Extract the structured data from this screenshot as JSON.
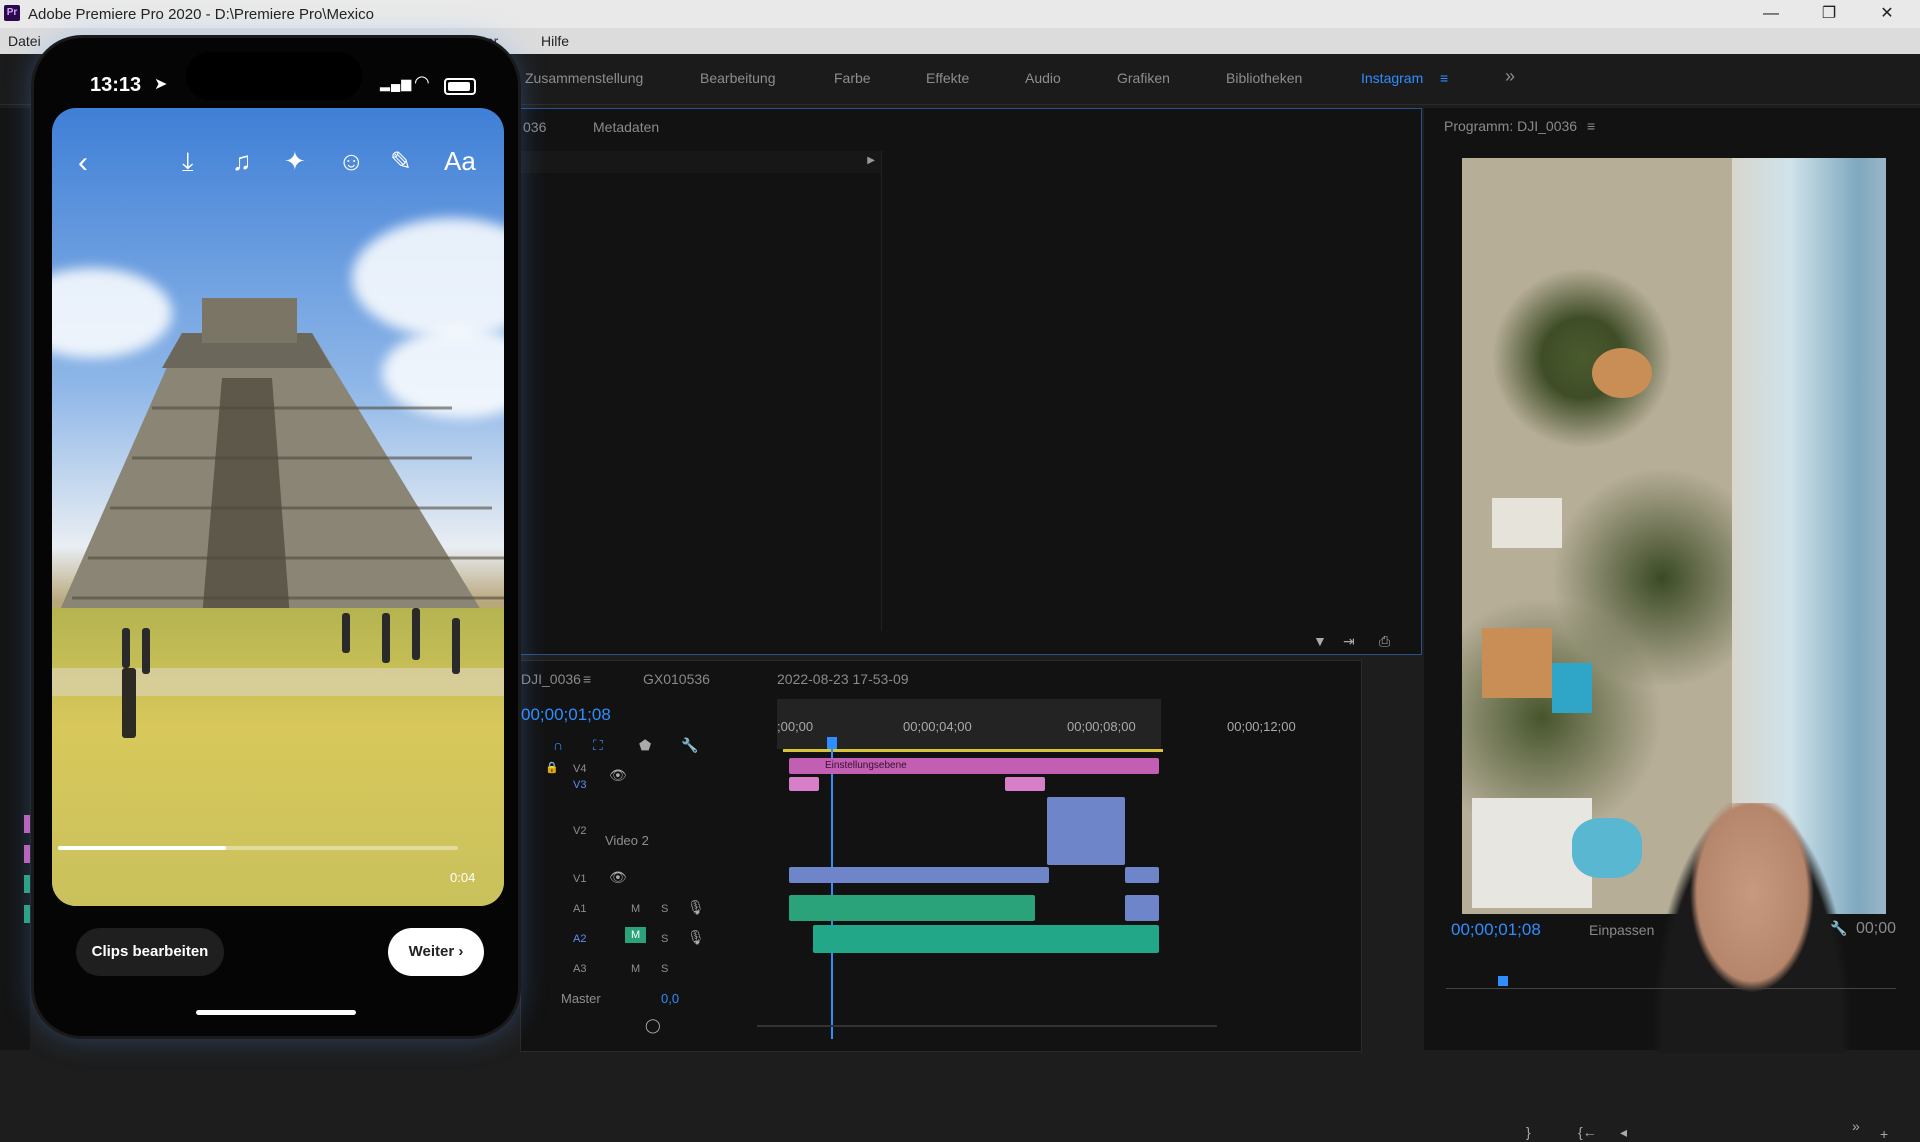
{
  "window": {
    "title": "Adobe Premiere Pro 2020 - D:\\Premiere Pro\\Mexico",
    "minimize": "—",
    "restore": "❐",
    "close": "✕"
  },
  "menu": {
    "file": "Datei",
    "help": "Hilfe",
    "window_partial": "ster"
  },
  "workspaces": {
    "tabs": [
      "Zusammenstellung",
      "Bearbeitung",
      "Farbe",
      "Effekte",
      "Audio",
      "Grafiken",
      "Bibliotheken",
      "Instagram"
    ],
    "active": "Instagram",
    "overflow": "»"
  },
  "source": {
    "tab_partial": "036",
    "metadata": "Metadaten"
  },
  "program": {
    "title": "Programm: DJI_0036",
    "timecode": "00;00;01;08",
    "fit": "Einpassen",
    "end_timecode": "00;00"
  },
  "timeline": {
    "tabs": [
      "DJI_0036",
      "GX010536",
      "2022-08-23 17-53-09"
    ],
    "timecode": "00;00;01;08",
    "ruler": [
      ";00;00",
      "00;00;04;00",
      "00;00;08;00",
      "00;00;12;00"
    ],
    "tracks": [
      "V4",
      "V3",
      "V2",
      "V1",
      "A1",
      "A2",
      "A3"
    ],
    "video2_label": "Video 2",
    "master_label": "Master",
    "master_value": "0,0",
    "adjustment_clip": "Einstellungsebene",
    "mute": "M",
    "solo": "S"
  },
  "phone": {
    "time": "13:13",
    "clip_time": "0:04",
    "progress_fraction": 0.42,
    "edit_clips": "Clips bearbeiten",
    "next": "Weiter",
    "text_tool": "Aa"
  },
  "colors": {
    "accent": "#2f8dff",
    "pink_clip": "#c25fb3",
    "audio_clip": "#2aa37a",
    "video_clip": "#6e86c9"
  }
}
